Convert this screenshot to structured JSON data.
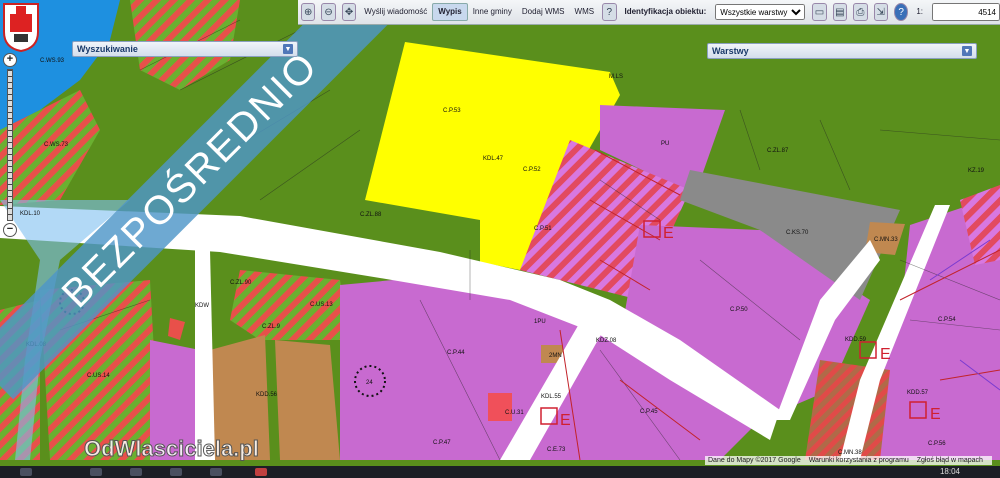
{
  "map": {
    "labels": [
      "C.WS.93",
      "C.P.53",
      "KDL.47",
      "C.P.52",
      "M.LS",
      "C.ZL.87",
      "C.ZL.88",
      "C.P.51",
      "PU",
      "C.KS.70",
      "C.MN.33",
      "KZ.19",
      "C.P.54",
      "C.P.50",
      "KDL.10",
      "C.WS.73",
      "C.ZL.90",
      "C.US.13",
      "KDW",
      "C.ZL.9",
      "KDL.08",
      "C.US.14",
      "C.P.44",
      "1PU",
      "2MN",
      "KDZ.08",
      "KDD.59",
      "KDD.56",
      "C.U.31",
      "KDL.55",
      "C.P.45",
      "C.P.47",
      "C.E.73",
      "KDD.57",
      "C.P.56",
      "C.MN.38"
    ],
    "circle_label": "24",
    "e_marker": "E"
  },
  "toolbar": {
    "send_message": "Wyślij wiadomość",
    "extract": "Wypis",
    "other_municipalities": "Inne gminy",
    "add_wms": "Dodaj WMS",
    "wms": "WMS",
    "identify_label": "Identyfikacja obiektu:",
    "identify_selected": "Wszystkie warstwy",
    "scale_prefix": "1:",
    "scale_value": "4514"
  },
  "panels": {
    "search": "Wyszukiwanie",
    "layers": "Warstwy"
  },
  "overlay": {
    "ribbon_text": "BEZPOŚREDNIO",
    "watermark": "OdWlasciciela.pl"
  },
  "footer": {
    "map_data": "Dane do Mapy ©2017 Google",
    "terms": "Warunki korzystania z programu",
    "report": "Zgłoś błąd w mapach"
  },
  "taskbar": {
    "time": "18:04"
  },
  "icons": {
    "zoom_in": "zoom-in-icon",
    "zoom_out": "zoom-out-icon",
    "identify": "identify-icon",
    "print": "print-icon",
    "help": "help-icon"
  },
  "colors": {
    "forest": "#5a8f1c",
    "building": "#c86ad0",
    "industrial": "#ffff00",
    "services": "#f0505a",
    "residential": "#c08850",
    "technical": "#8a8a8a",
    "water": "#1e90e0",
    "road": "#ffffff"
  }
}
